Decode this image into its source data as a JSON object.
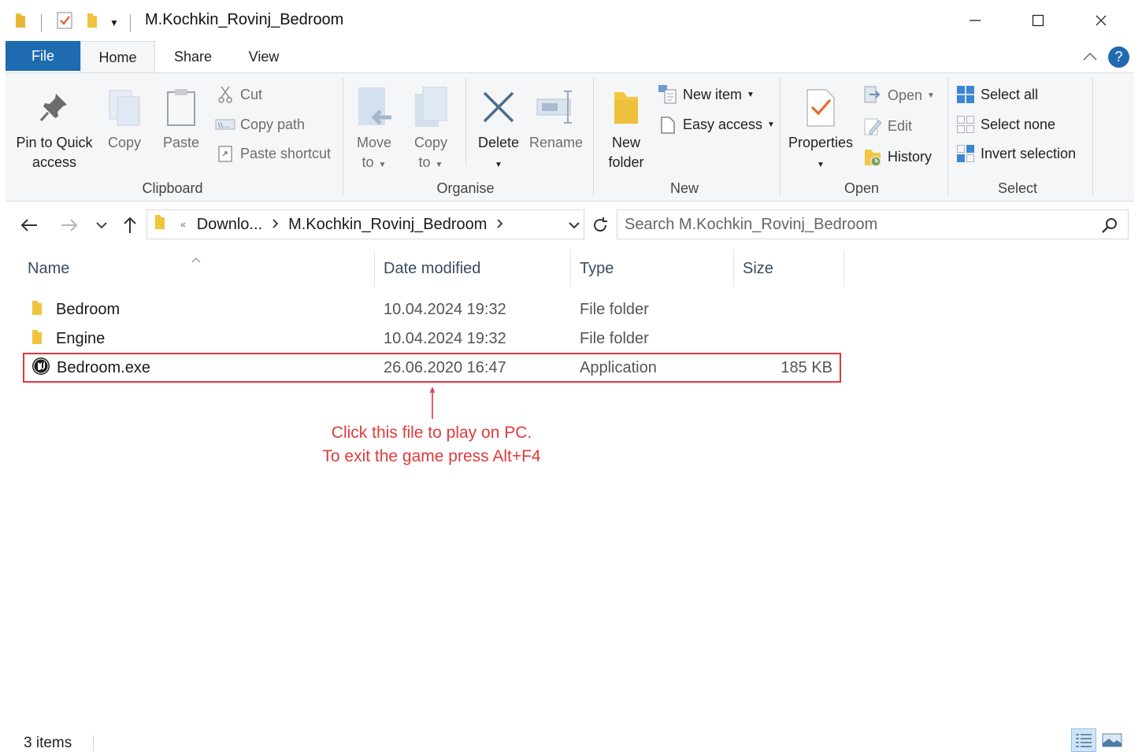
{
  "window": {
    "title": "M.Kochkin_Rovinj_Bedroom",
    "minimize": "—",
    "maximize": "☐",
    "close": "✕"
  },
  "tabs": {
    "file": "File",
    "home": "Home",
    "share": "Share",
    "view": "View",
    "collapse": "^",
    "help": "?"
  },
  "ribbon": {
    "clipboard": {
      "label": "Clipboard",
      "pin_line1": "Pin to Quick",
      "pin_line2": "access",
      "copy": "Copy",
      "paste": "Paste",
      "cut": "Cut",
      "copy_path": "Copy path",
      "paste_shortcut": "Paste shortcut"
    },
    "organise": {
      "label": "Organise",
      "move_line1": "Move",
      "move_line2": "to",
      "copy_line1": "Copy",
      "copy_line2": "to",
      "delete": "Delete",
      "rename": "Rename"
    },
    "new": {
      "label": "New",
      "folder_line1": "New",
      "folder_line2": "folder",
      "new_item": "New item",
      "easy_access": "Easy access"
    },
    "open": {
      "label": "Open",
      "properties": "Properties",
      "open": "Open",
      "edit": "Edit",
      "history": "History"
    },
    "select": {
      "label": "Select",
      "select_all": "Select all",
      "select_none": "Select none",
      "invert": "Invert selection"
    }
  },
  "address": {
    "overflow": "«",
    "crumb1": "Downlo...",
    "crumb2": "M.Kochkin_Rovinj_Bedroom",
    "search_placeholder": "Search M.Kochkin_Rovinj_Bedroom"
  },
  "columns": {
    "name": "Name",
    "date": "Date modified",
    "type": "Type",
    "size": "Size"
  },
  "files": [
    {
      "name": "Bedroom",
      "date": "10.04.2024 19:32",
      "type": "File folder",
      "size": ""
    },
    {
      "name": "Engine",
      "date": "10.04.2024 19:32",
      "type": "File folder",
      "size": ""
    },
    {
      "name": "Bedroom.exe",
      "date": "26.06.2020 16:47",
      "type": "Application",
      "size": "185 KB"
    }
  ],
  "annotation": {
    "line1": "Click this file to play on PC.",
    "line2": "To exit the game press Alt+F4"
  },
  "status": {
    "items": "3 items"
  },
  "colors": {
    "accent": "#1f6bb0",
    "highlight": "#e03a3a",
    "folder": "#f0c43c"
  }
}
